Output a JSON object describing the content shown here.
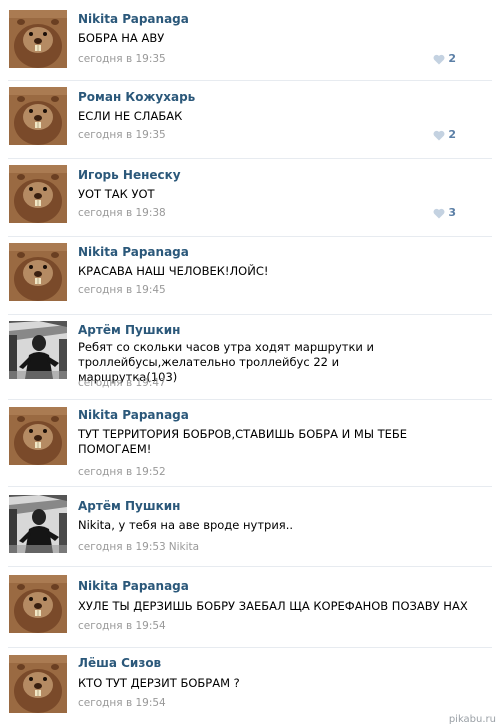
{
  "comments": [
    {
      "author": "Nikita Papanaga",
      "text": "БОБРА НА АВУ",
      "time": "сегодня в 19:35",
      "reply_to": "",
      "likes": "2",
      "avatar": "beaver-avatar"
    },
    {
      "author": "Роман Кожухарь",
      "text": "ЕСЛИ НЕ СЛАБАК",
      "time": "сегодня в 19:35",
      "reply_to": "",
      "likes": "2",
      "avatar": "beaver-avatar"
    },
    {
      "author": "Игорь Ненеску",
      "text": "УОТ ТАК УОТ",
      "time": "сегодня в 19:38",
      "reply_to": "",
      "likes": "3",
      "avatar": "beaver-avatar"
    },
    {
      "author": "Nikita Papanaga",
      "text": "КРАСАВА НАШ ЧЕЛОВЕК!ЛОЙС!",
      "time": "сегодня в 19:45",
      "reply_to": "",
      "likes": "",
      "avatar": "beaver-avatar"
    },
    {
      "author": "Артём Пушкин",
      "text": "Ребят со скольки часов утра ходят маршрутки и троллейбусы,желательно троллейбус 22 и маршрутка(103)",
      "time": "сегодня в 19:47",
      "reply_to": "",
      "likes": "",
      "avatar": "bw-photo-avatar"
    },
    {
      "author": "Nikita Papanaga",
      "text": "ТУТ ТЕРРИТОРИЯ БОБРОВ,СТАВИШЬ БОБРА И МЫ ТЕБЕ ПОМОГАЕМ!",
      "time": "сегодня в 19:52",
      "reply_to": "",
      "likes": "",
      "avatar": "beaver-avatar"
    },
    {
      "author": "Артём Пушкин",
      "text": "Nikita, у тебя на аве вроде нутрия..",
      "time": "сегодня в 19:53",
      "reply_to": "Nikita",
      "likes": "",
      "avatar": "bw-photo-avatar"
    },
    {
      "author": "Nikita Papanaga",
      "text": "ХУЛЕ ТЫ ДЕРЗИШЬ БОБРУ ЗАЕБАЛ ЩА КОРЕФАНОВ ПОЗАВУ НАХ",
      "time": "сегодня в 19:54",
      "reply_to": "",
      "likes": "",
      "avatar": "beaver-avatar"
    },
    {
      "author": "Лёша Сизов",
      "text": "КТО ТУТ ДЕРЗИТ БОБРАМ ?",
      "time": "сегодня в 19:54",
      "reply_to": "",
      "likes": "",
      "avatar": "beaver-avatar"
    }
  ],
  "watermark": "pikabu.ru",
  "colors": {
    "author": "#2b587a",
    "meta": "#999999",
    "like": "#5b7fa6",
    "separator": "#e7ebf0"
  }
}
